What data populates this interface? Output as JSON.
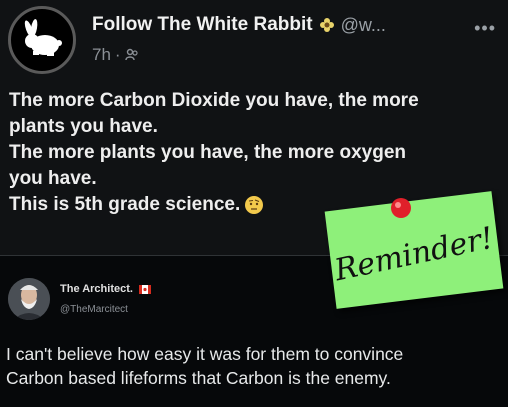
{
  "post": {
    "author_name": "Follow The White Rabbit",
    "handle": "@w...",
    "more_icon": "more-icon",
    "time_ago": "7h",
    "separator": "·",
    "audience_icon": "people-icon",
    "lines": [
      "The more Carbon Dioxide you have, the more",
      "plants you have.",
      "The more plants you have, the more oxygen",
      "you have.",
      "This is 5th grade science."
    ],
    "emoji": "face-with-eyebrow-icon"
  },
  "reply": {
    "author_name": "The Architect.",
    "handle": "@TheMarcitect",
    "flag_icon": "canada-flag-icon",
    "lines": [
      "I can't believe how easy it was for them to convince",
      "Carbon based lifeforms that Carbon is the enemy."
    ]
  },
  "sticky_note": {
    "text": "Reminder!",
    "color": "#8ef07a",
    "pin_color": "#e0202a"
  },
  "colors": {
    "background": "#000000",
    "post_background": "#101214",
    "text_primary": "#e7e9ea",
    "text_secondary": "#8b9096"
  }
}
